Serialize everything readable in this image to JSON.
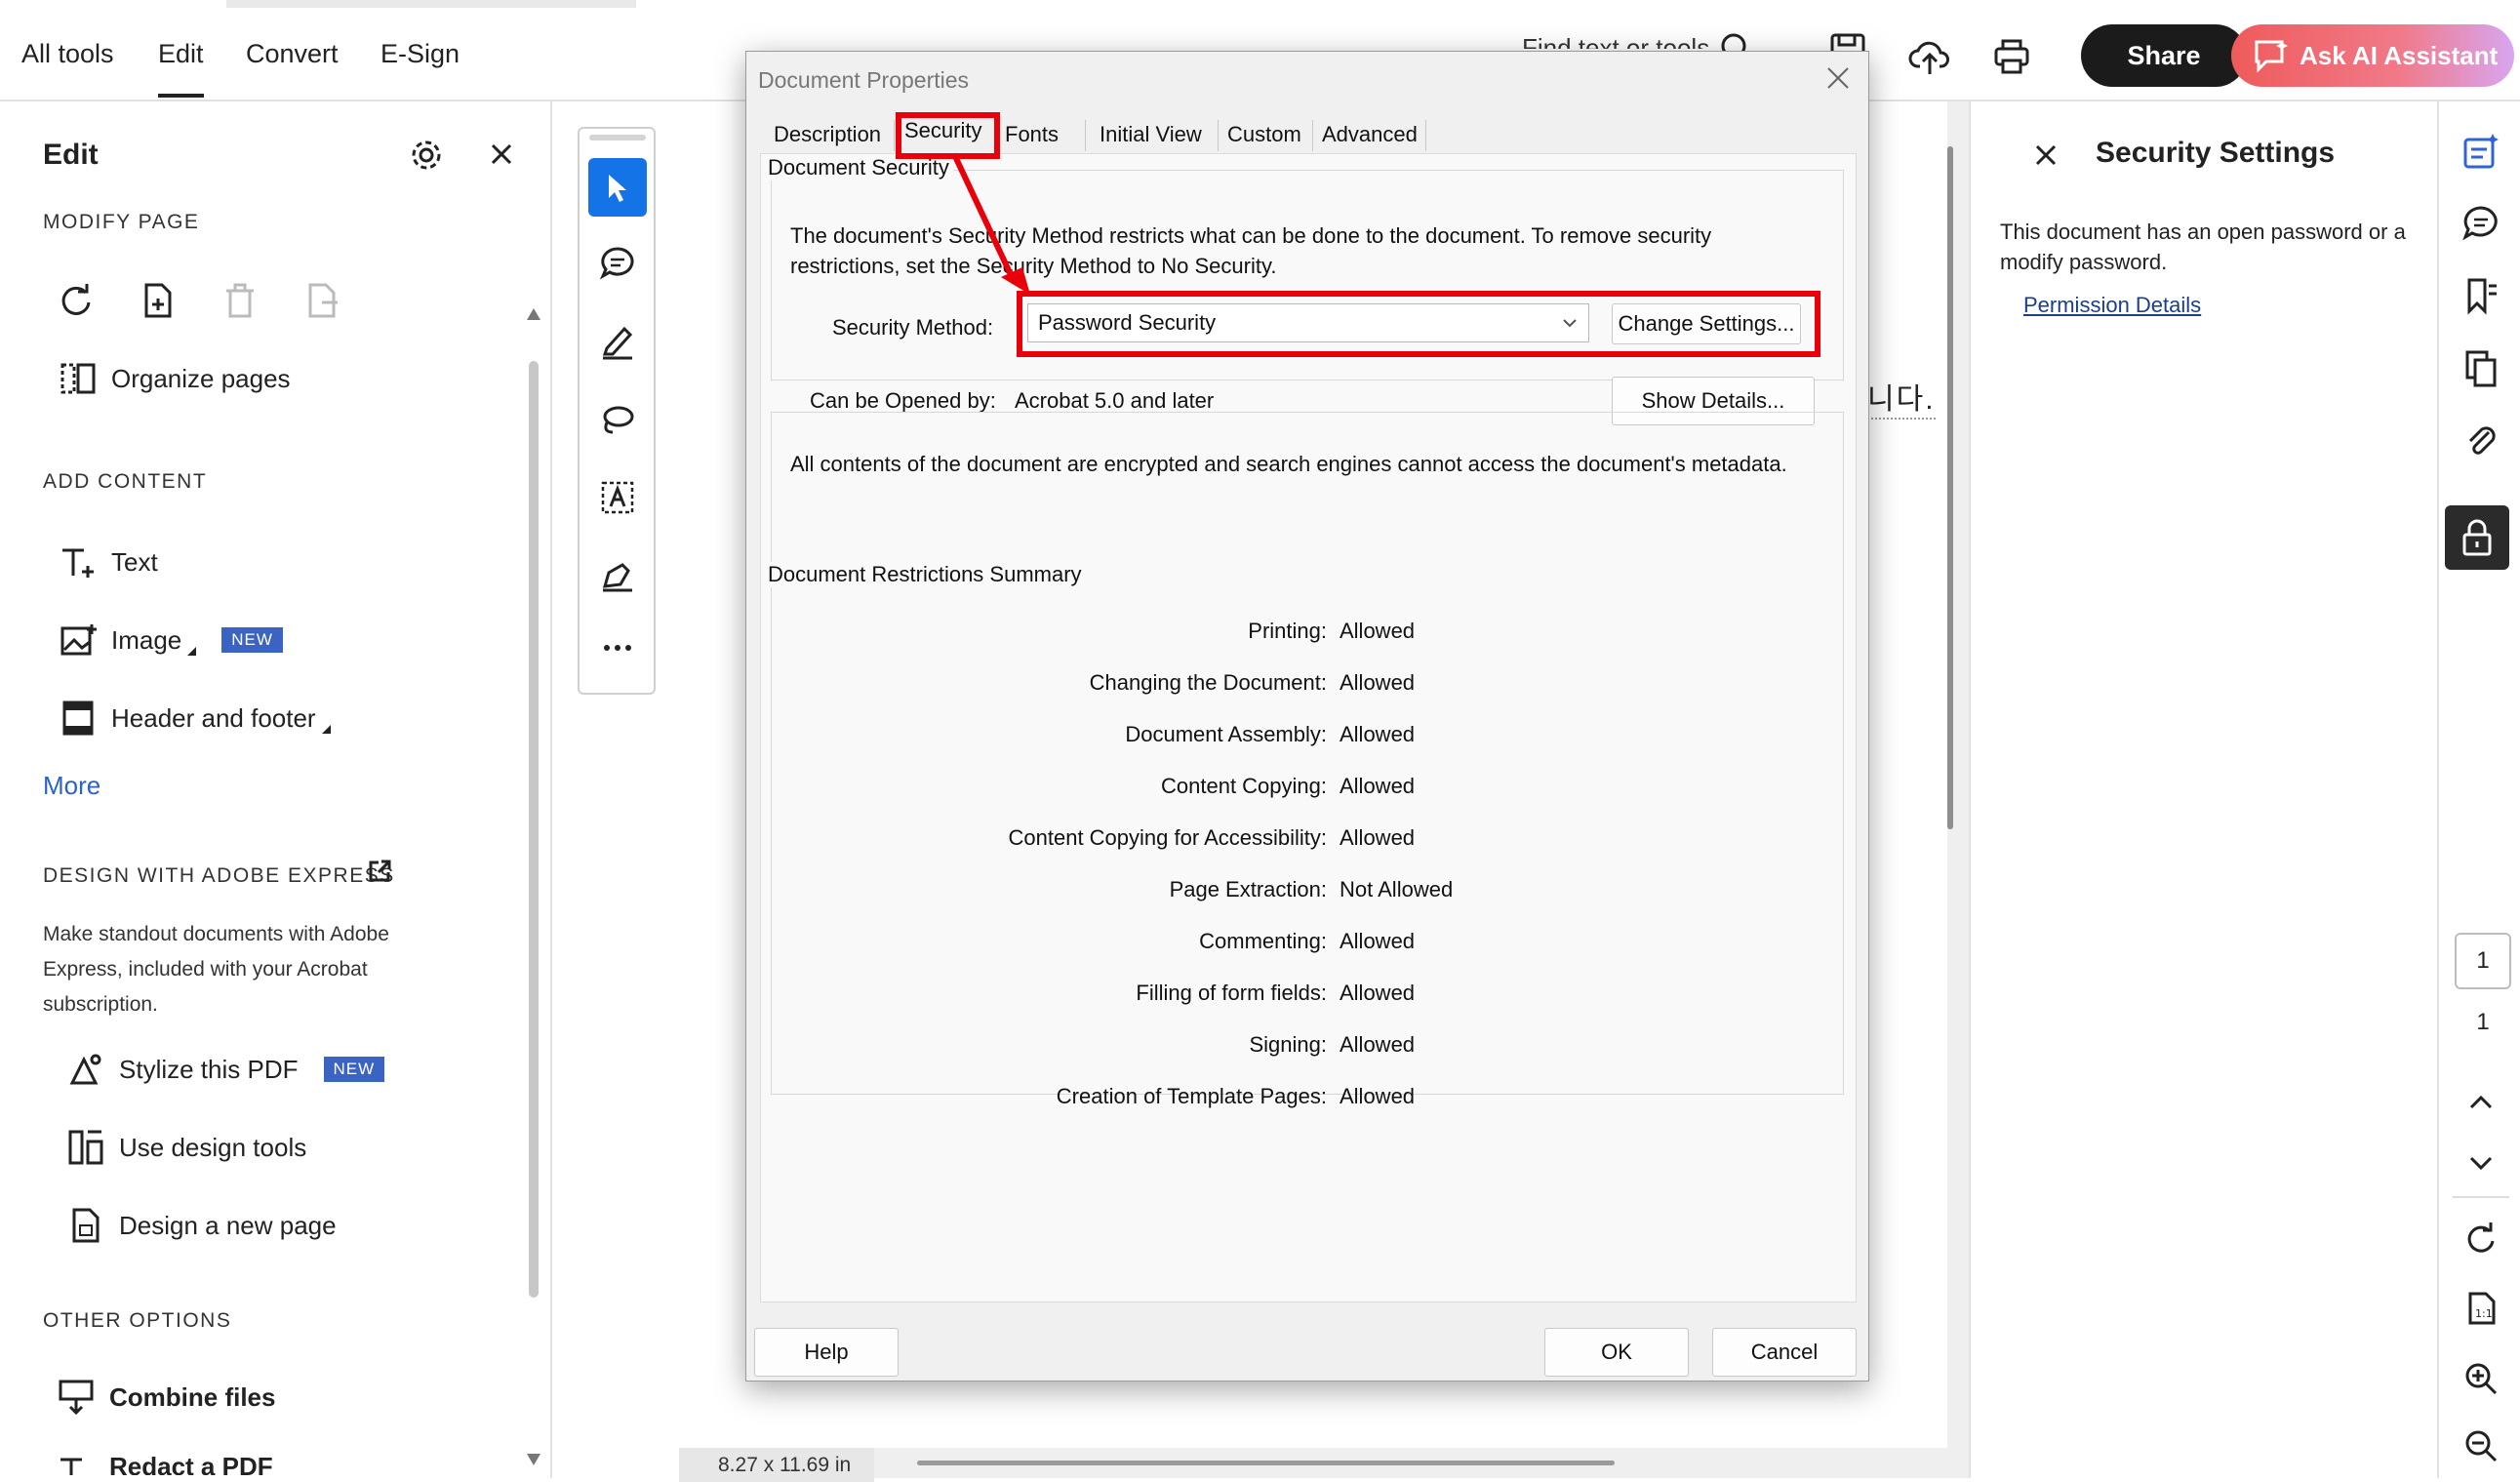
{
  "topbar": {
    "tabs": [
      {
        "label": "All tools"
      },
      {
        "label": "Edit"
      },
      {
        "label": "Convert"
      },
      {
        "label": "E-Sign"
      }
    ],
    "search_placeholder": "Find text or tools",
    "share_label": "Share",
    "ai_label": "Ask AI Assistant"
  },
  "left_panel": {
    "title": "Edit",
    "modify_page": {
      "heading": "MODIFY PAGE",
      "organize": "Organize pages"
    },
    "add_content": {
      "heading": "ADD CONTENT",
      "text": "Text",
      "image": "Image",
      "image_badge": "NEW",
      "header_footer": "Header and footer",
      "more": "More"
    },
    "design": {
      "heading": "DESIGN WITH ADOBE EXPRESS",
      "description": "Make standout documents with Adobe Express, included with your Acrobat subscription.",
      "stylize": "Stylize this PDF",
      "stylize_badge": "NEW",
      "design_tools": "Use design tools",
      "new_page": "Design a new page"
    },
    "other": {
      "heading": "OTHER OPTIONS",
      "combine": "Combine files",
      "redact": "Redact a PDF"
    }
  },
  "document": {
    "page_size": "8.27 x 11.69 in",
    "text_fragment": "니다."
  },
  "dialog": {
    "title": "Document Properties",
    "tabs": [
      {
        "label": "Description"
      },
      {
        "label": "Security"
      },
      {
        "label": "Fonts"
      },
      {
        "label": "Initial View"
      },
      {
        "label": "Custom"
      },
      {
        "label": "Advanced"
      }
    ],
    "security_group": "Document Security",
    "security_desc": "The document's Security Method restricts what can be done to the document. To remove security restrictions, set the Security Method to No Security.",
    "method_label": "Security Method:",
    "method_value": "Password Security",
    "change_settings": "Change Settings...",
    "opened_by_label": "Can be Opened by:",
    "opened_by_value": "Acrobat 5.0 and later",
    "show_details": "Show Details...",
    "encrypted_note": "All contents of the document are encrypted and search engines cannot access the document's metadata.",
    "restrictions_group": "Document Restrictions Summary",
    "restrictions": [
      {
        "label": "Printing:",
        "value": "Allowed"
      },
      {
        "label": "Changing the Document:",
        "value": "Allowed"
      },
      {
        "label": "Document Assembly:",
        "value": "Allowed"
      },
      {
        "label": "Content Copying:",
        "value": "Allowed"
      },
      {
        "label": "Content Copying for Accessibility:",
        "value": "Allowed"
      },
      {
        "label": "Page Extraction:",
        "value": "Not Allowed"
      },
      {
        "label": "Commenting:",
        "value": "Allowed"
      },
      {
        "label": "Filling of form fields:",
        "value": "Allowed"
      },
      {
        "label": "Signing:",
        "value": "Allowed"
      },
      {
        "label": "Creation of Template Pages:",
        "value": "Allowed"
      }
    ],
    "help": "Help",
    "ok": "OK",
    "cancel": "Cancel"
  },
  "right_panel": {
    "title": "Security Settings",
    "text": "This document has an open password or a modify password.",
    "link": "Permission Details"
  },
  "right_rail": {
    "current_page": "1",
    "total_pages": "1"
  },
  "colors": {
    "accent_blue": "#1473e6",
    "annotation_red": "#e8000b",
    "badge_blue": "#3b63c4"
  }
}
